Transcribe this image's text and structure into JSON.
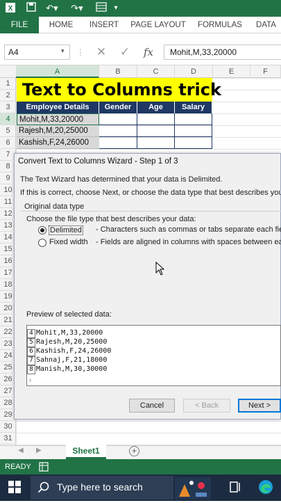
{
  "ribbon": {
    "tabs": [
      "FILE",
      "HOME",
      "INSERT",
      "PAGE LAYOUT",
      "FORMULAS",
      "DATA"
    ]
  },
  "formula_bar": {
    "name_box": "A4",
    "formula": "Mohit,M,33,20000",
    "fx": "fx"
  },
  "columns": [
    "A",
    "B",
    "C",
    "D",
    "E",
    "F"
  ],
  "rows": [
    "1",
    "2",
    "3",
    "4",
    "5",
    "6",
    "7",
    "8",
    "9",
    "10",
    "11",
    "12",
    "13",
    "14",
    "15",
    "16",
    "17",
    "18",
    "19",
    "20",
    "21",
    "22",
    "23",
    "24",
    "25",
    "26",
    "27",
    "28",
    "29",
    "30",
    "31"
  ],
  "sheet": {
    "title": "Text to Columns trick",
    "headers": [
      "Employee Details",
      "Gender",
      "Age",
      "Salary"
    ],
    "data_rows": [
      "Mohit,M,33,20000",
      "Rajesh,M,20,25000",
      "Kashish,F,24,26000"
    ]
  },
  "dialog": {
    "title": "Convert Text to Columns Wizard - Step 1 of 3",
    "line1": "The Text Wizard has determined that your data is Delimited.",
    "line2": "If this is correct, choose Next, or choose the data type that best describes your",
    "group_label": "Original data type",
    "choose_label": "Choose the file type that best describes your data:",
    "options": [
      {
        "label": "Delimited",
        "desc": "- Characters such as commas or tabs separate each field",
        "selected": true
      },
      {
        "label": "Fixed width",
        "desc": "- Fields are aligned in columns with spaces between ea",
        "selected": false
      }
    ],
    "preview_label": "Preview of selected data:",
    "preview": [
      {
        "n": "4",
        "text": "Mohit,M,33,20000"
      },
      {
        "n": "5",
        "text": "Rajesh,M,20,25000"
      },
      {
        "n": "6",
        "text": "Kashish,F,24,26000"
      },
      {
        "n": "7",
        "text": "Sahnaj,F,21,18000"
      },
      {
        "n": "8",
        "text": "Manish,M,30,30000"
      }
    ],
    "buttons": {
      "cancel": "Cancel",
      "back": "< Back",
      "next": "Next >"
    }
  },
  "sheet_tab": "Sheet1",
  "status": "READY",
  "taskbar": {
    "search_placeholder": "Type here to search"
  },
  "colors": {
    "excel_green": "#217346",
    "header_navy": "#1f3864",
    "title_yellow": "#ffff00"
  }
}
